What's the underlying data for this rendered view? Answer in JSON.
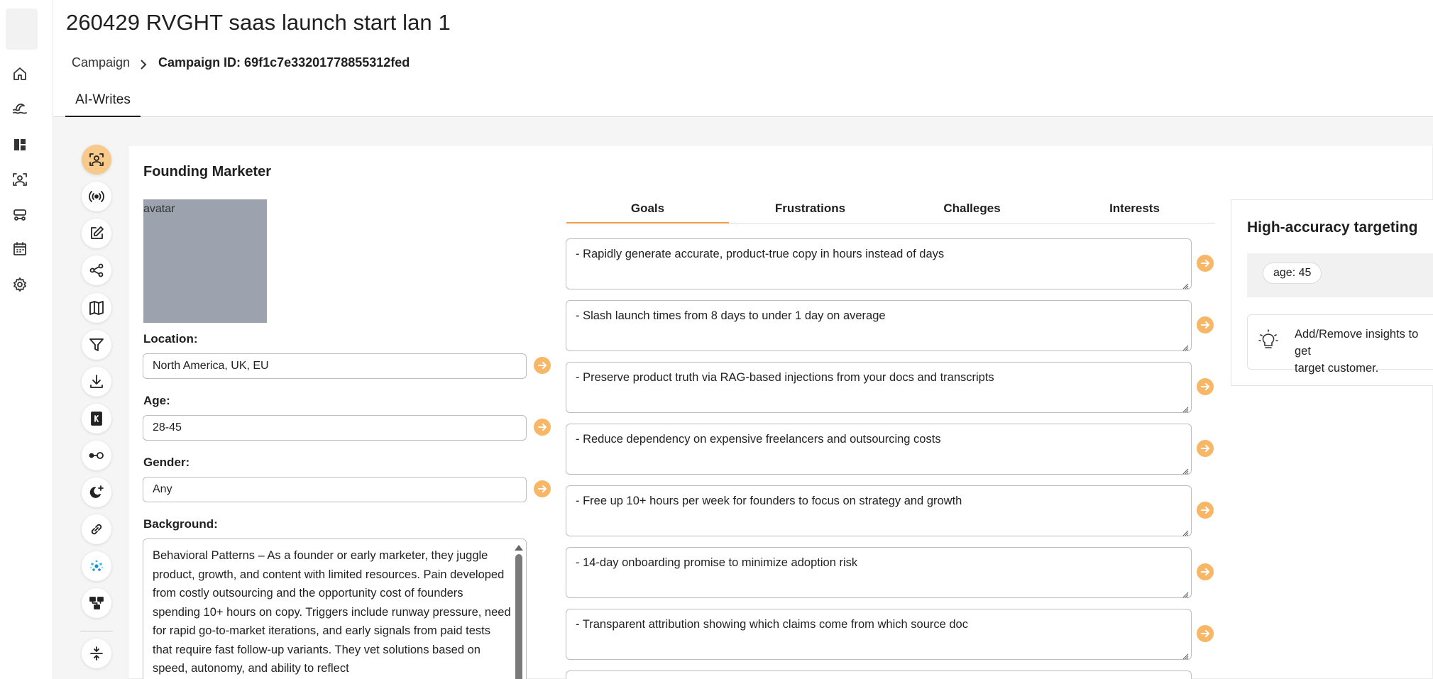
{
  "page": {
    "title": "260429 RVGHT saas launch start lan 1",
    "breadcrumb": {
      "parent": "Campaign",
      "current": "Campaign ID: 69f1c7e33201778855312fed"
    },
    "tabs": [
      {
        "label": "AI-Writes",
        "active": true
      }
    ]
  },
  "rail": {
    "items": [
      {
        "name": "home-icon"
      },
      {
        "name": "wave-icon"
      },
      {
        "name": "dashboard-icon"
      },
      {
        "name": "persona-icon"
      },
      {
        "name": "automation-icon"
      },
      {
        "name": "calendar-icon"
      },
      {
        "name": "settings-icon"
      }
    ]
  },
  "tools": [
    {
      "name": "persona-icon",
      "active": true
    },
    {
      "name": "broadcast-icon"
    },
    {
      "name": "edit-icon"
    },
    {
      "name": "share-nodes-icon"
    },
    {
      "name": "map-icon"
    },
    {
      "name": "filter-icon"
    },
    {
      "name": "download-icon"
    },
    {
      "name": "book-k-icon"
    },
    {
      "name": "connect-icon"
    },
    {
      "name": "moon-sparkle-icon"
    },
    {
      "name": "link-icon"
    },
    {
      "name": "dots-cluster-icon"
    },
    {
      "name": "hierarchy-icon"
    },
    {
      "name": "expand-collapse-icon"
    }
  ],
  "persona": {
    "name": "Founding Marketer",
    "avatar_alt": "avatar",
    "location": {
      "label": "Location:",
      "value": "North America, UK, EU"
    },
    "age": {
      "label": "Age:",
      "value": "28-45"
    },
    "gender": {
      "label": "Gender:",
      "value": "Any"
    },
    "background": {
      "label": "Background:",
      "text": "Behavioral Patterns – As a founder or early marketer, they juggle product, growth, and content with limited resources. Pain developed from costly outsourcing and the opportunity cost of founders spending 10+ hours on copy. Triggers include runway pressure, need for rapid go-to-market iterations, and early signals from paid tests that require fast follow-up variants. They vet solutions based on speed, autonomy, and ability to reflect"
    }
  },
  "insight_tabs": [
    {
      "label": "Goals",
      "active": true
    },
    {
      "label": "Frustrations"
    },
    {
      "label": "Challeges"
    },
    {
      "label": "Interests"
    }
  ],
  "goals": [
    "- Rapidly generate accurate, product-true copy in hours instead of days",
    "- Slash launch times from 8 days to under 1 day on average",
    "- Preserve product truth via RAG-based injections from your docs and transcripts",
    "- Reduce dependency on expensive freelancers and outsourcing costs",
    "- Free up 10+ hours per week for founders to focus on strategy and growth",
    "- 14-day onboarding promise to minimize adoption risk",
    "- Transparent attribution showing which claims come from which source doc"
  ],
  "targeting": {
    "title": "High-accuracy targeting",
    "chips": [
      "age: 45"
    ],
    "info": "Add/Remove insights to get\ntarget customer."
  },
  "colors": {
    "accent": "#f7b766",
    "tab_underline": "#f0a04b",
    "active_tool": "#f7c98a",
    "avatar": "#9ca3af"
  }
}
